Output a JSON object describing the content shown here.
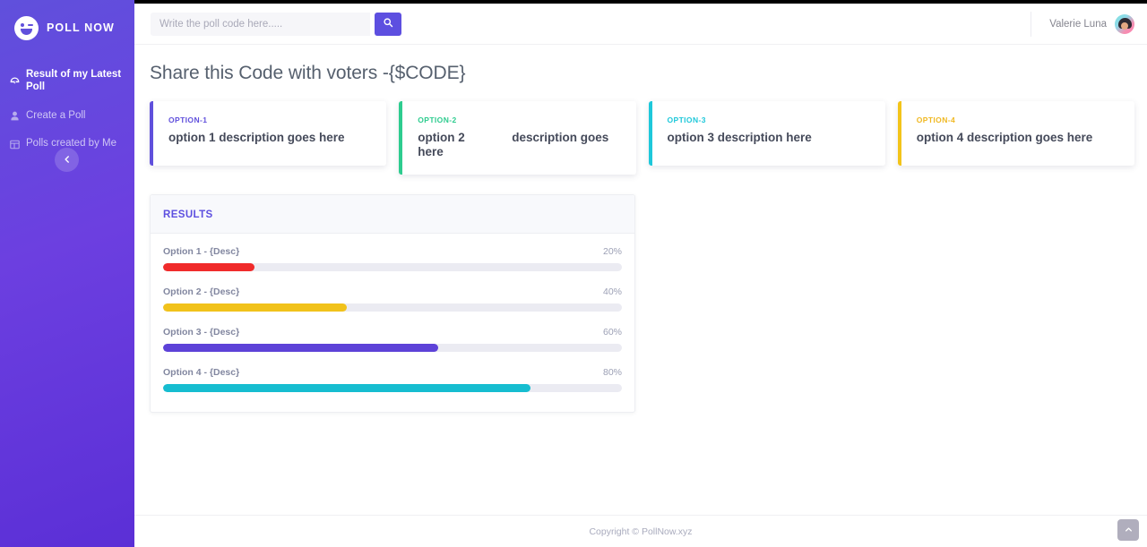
{
  "sidebar": {
    "brand": "POLL NOW",
    "logo_icon": "wink-smiley-icon",
    "items": [
      {
        "label": "Result of my Latest Poll",
        "icon": "dashboard-icon",
        "active": true
      },
      {
        "label": "Create a Poll",
        "icon": "user-icon",
        "active": false
      },
      {
        "label": "Polls created by Me",
        "icon": "table-grid-icon",
        "active": false
      }
    ],
    "collapse_icon": "chevron-left-icon"
  },
  "topbar": {
    "search": {
      "placeholder": "Write the poll code here.....",
      "value": "",
      "button_icon": "search-icon"
    },
    "user": {
      "name": "Valerie Luna",
      "avatar_icon": "avatar"
    }
  },
  "page": {
    "title": "Share this Code with voters -{$CODE}"
  },
  "option_cards": [
    {
      "label": "OPTION-1",
      "description": "option 1 description goes here",
      "accent": "#6050dc",
      "label_color": "#6050dc"
    },
    {
      "label": "OPTION-2",
      "description": "option 2              description goes here",
      "accent": "#2ecc8f",
      "label_color": "#2ecc8f"
    },
    {
      "label": "OPTION-3",
      "description": "option 3 description here",
      "accent": "#1ec8da",
      "label_color": "#1ec8da"
    },
    {
      "label": "OPTION-4",
      "description": "option 4 description goes here",
      "accent": "#f3c41a",
      "label_color": "#f0b821"
    }
  ],
  "results": {
    "title": "RESULTS",
    "rows": [
      {
        "label": "Option 1 - {Desc}",
        "percent_text": "20%",
        "percent": 20,
        "color": "#f02b2b"
      },
      {
        "label": "Option 2 - {Desc}",
        "percent_text": "40%",
        "percent": 40,
        "color": "#f1c21b"
      },
      {
        "label": "Option 3 - {Desc}",
        "percent_text": "60%",
        "percent": 60,
        "color": "#5d42d8"
      },
      {
        "label": "Option 4 - {Desc}",
        "percent_text": "80%",
        "percent": 80,
        "color": "#16bdd0"
      }
    ]
  },
  "footer": {
    "copyright": "Copyright © PollNow.xyz",
    "scrolltop_icon": "chevron-up-icon"
  }
}
